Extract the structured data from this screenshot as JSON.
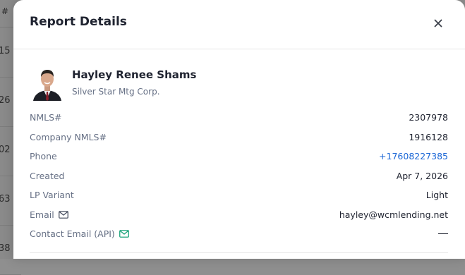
{
  "background": {
    "column_header": "#",
    "cells": [
      "15",
      "26",
      "02",
      "63",
      "38"
    ]
  },
  "modal": {
    "title": "Report Details",
    "close_glyph": "×",
    "profile": {
      "name": "Hayley Renee Shams",
      "company": "Silver Star Mtg Corp."
    },
    "details": [
      {
        "label": "NMLS#",
        "value": "2307978"
      },
      {
        "label": "Company NMLS#",
        "value": "1916128"
      },
      {
        "label": "Phone",
        "value": "+17608227385"
      },
      {
        "label": "Created",
        "value": "Apr 7, 2026"
      },
      {
        "label": "LP Variant",
        "value": "Light"
      },
      {
        "label": "Email",
        "value": "hayley@wcmlending.net",
        "icon": "mail-icon"
      },
      {
        "label": "Contact Email (API)",
        "value": "—",
        "icon": "mail-icon-green"
      }
    ],
    "colors": {
      "link": "#1a66d6",
      "mail_icon_green": "#1aa37a"
    }
  }
}
